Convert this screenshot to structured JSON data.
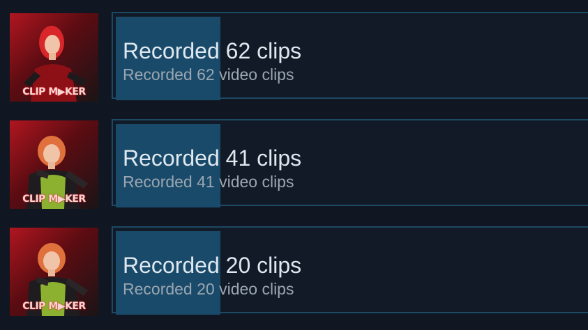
{
  "accent_color": "#1a4a6a",
  "border_color": "#1c4964",
  "achievements": [
    {
      "logo_text": "CLIP M▶KER",
      "title": "Recorded 62 clips",
      "description": "Recorded 62 video clips",
      "progress": 0.22,
      "hair_color": "#d8262a",
      "outfit_color": "#8c1016"
    },
    {
      "logo_text": "CLIP M▶KER",
      "title": "Recorded 41 clips",
      "description": "Recorded 41 video clips",
      "progress": 0.22,
      "hair_color": "#e0703c",
      "outfit_color": "#8cb030"
    },
    {
      "logo_text": "CLIP M▶KER",
      "title": "Recorded 20 clips",
      "description": "Recorded 20 video clips",
      "progress": 0.22,
      "hair_color": "#e0703c",
      "outfit_color": "#8cb030"
    }
  ]
}
